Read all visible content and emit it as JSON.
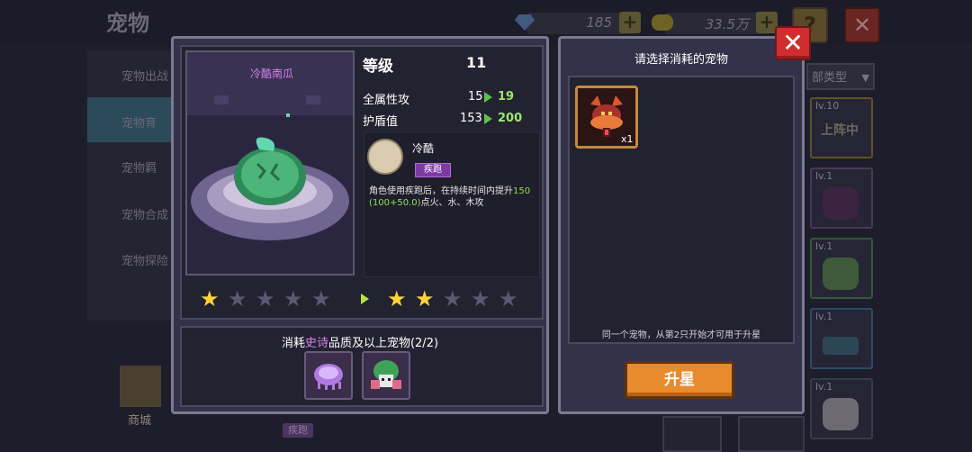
{
  "background": {
    "title": "宠物",
    "resources": {
      "gems": "185",
      "coins": "33.5万"
    },
    "help_label": "?",
    "side_menu": [
      "宠物出战",
      "宠物育",
      "宠物羁",
      "宠物合成",
      "宠物探险"
    ],
    "shop_label": "商城",
    "bottom_tag": "疾跑",
    "filter_dropdown": "部类型",
    "right_cards": [
      {
        "level": "lv.10",
        "tag": "上阵中"
      },
      {
        "level": "lv.1"
      },
      {
        "level": "lv.1"
      },
      {
        "level": "lv.1"
      },
      {
        "level": "lv.1"
      }
    ]
  },
  "upgrade_panel": {
    "pet_name": "冷酷南瓜",
    "level_label": "等级",
    "level_value": "11",
    "stats": [
      {
        "label": "全属性攻",
        "old": "15",
        "new": "19"
      },
      {
        "label": "护盾值",
        "old": "153",
        "new": "200"
      }
    ],
    "skill": {
      "name": "冷酷",
      "tag": "疾跑",
      "desc_prefix": "角色使用疾跑后，在持续时间内提升",
      "desc_value": "150(100+50.0)",
      "desc_suffix": "点火、水、木攻"
    },
    "stars_current": 1,
    "stars_next": 2,
    "stars_max": 5,
    "requirement": {
      "prefix": "消耗",
      "quality": "史诗",
      "suffix": "品质及以上宠物(2/2)"
    }
  },
  "select_panel": {
    "title": "请选择消耗的宠物",
    "selected_count": "x1",
    "note": "同一个宠物，从第2只开始才可用于升星",
    "button_label": "升星"
  },
  "close_label": "✕",
  "colors": {
    "accent_orange": "#e88a2e",
    "epic_purple": "#d880f0",
    "stat_green": "#9ce86a",
    "star_gold": "#ffd23a",
    "close_red": "#d02e2e"
  }
}
